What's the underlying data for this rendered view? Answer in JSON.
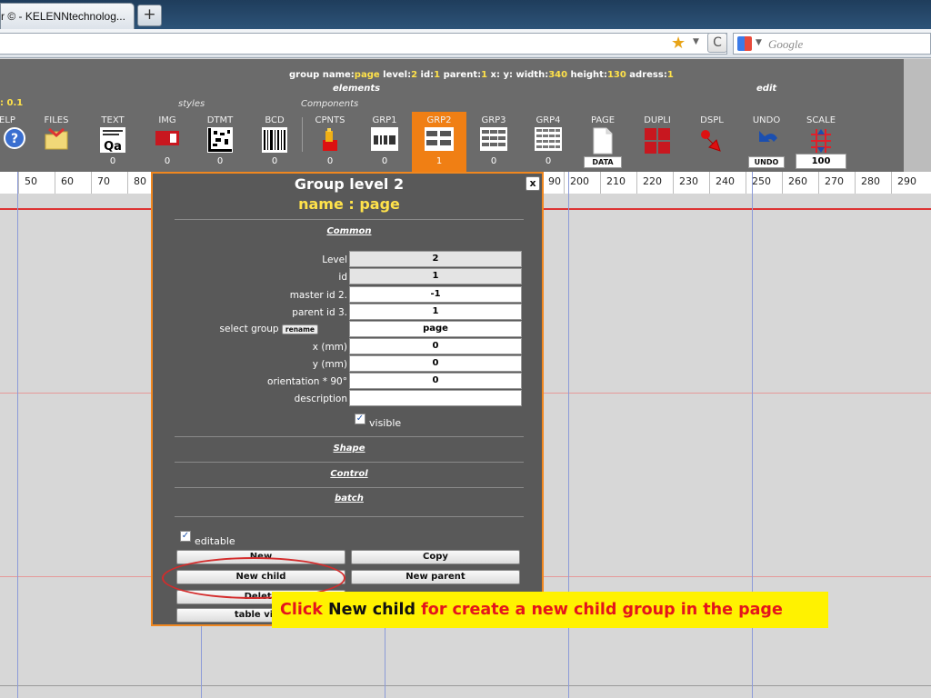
{
  "browser": {
    "tab_title": "r © - KELENNtechnolog...",
    "new_tab": "+",
    "search_placeholder": "Google",
    "reload": "C"
  },
  "toolbar": {
    "info": {
      "group_name_label": "group name:",
      "group_name": "page",
      "level_label": " level:",
      "level": "2",
      "id_label": " id:",
      "id": "1",
      "parent_label": " parent:",
      "parent": "1",
      "xy_label": " x: y: width:",
      "width": "340",
      "height_label": " height:",
      "height": "130",
      "adress_label": " adress:",
      "adress": "1"
    },
    "section_elements": "elements",
    "section_edit": "edit",
    "label_styles": "styles",
    "label_components": "Components",
    "zoom": ": 0.1",
    "buttons": [
      {
        "label": "ELP",
        "count": ""
      },
      {
        "label": "FILES",
        "count": ""
      },
      {
        "label": "TEXT",
        "count": "0"
      },
      {
        "label": "IMG",
        "count": "0"
      },
      {
        "label": "DTMT",
        "count": "0"
      },
      {
        "label": "BCD",
        "count": "0"
      },
      {
        "label": "CPNTS",
        "count": "0"
      },
      {
        "label": "GRP1",
        "count": "0"
      },
      {
        "label": "GRP2",
        "count": "1"
      },
      {
        "label": "GRP3",
        "count": "0"
      },
      {
        "label": "GRP4",
        "count": "0"
      },
      {
        "label": "PAGE",
        "count": "DATA"
      },
      {
        "label": "DUPLI",
        "count": ""
      },
      {
        "label": "DSPL",
        "count": ""
      },
      {
        "label": "UNDO",
        "count": "UNDO"
      },
      {
        "label": "SCALE",
        "count": "100"
      }
    ]
  },
  "ruler": [
    "50",
    "60",
    "70",
    "80",
    "90",
    "200",
    "210",
    "220",
    "230",
    "240",
    "250",
    "260",
    "270",
    "280",
    "290"
  ],
  "dialog": {
    "title": "Group level 2",
    "subtitle": "name : page",
    "close": "x",
    "section_common": "Common",
    "fields": [
      {
        "label": "Level",
        "value": "2"
      },
      {
        "label": "id",
        "value": "1"
      },
      {
        "label": "master id 2.",
        "value": "-1"
      },
      {
        "label": "parent id 3.",
        "value": "1"
      },
      {
        "label": "select group",
        "value": "page"
      },
      {
        "label": "x (mm)",
        "value": "0"
      },
      {
        "label": "y (mm)",
        "value": "0"
      },
      {
        "label": "orientation * 90°",
        "value": "0"
      },
      {
        "label": "description",
        "value": ""
      }
    ],
    "rename_button": "rename",
    "visible_label": "visible",
    "section_shape": "Shape",
    "section_control": "Control",
    "section_batch": "batch",
    "editable_label": "editable",
    "btn_new": "New",
    "btn_copy": "Copy",
    "btn_new_child": "New child",
    "btn_new_parent": "New parent",
    "btn_delete": "Delete",
    "btn_table_view": "table view"
  },
  "callout": {
    "part1": "Click ",
    "part2": "New child",
    "part3": " for create a new child group in the page"
  },
  "colors": {
    "accent_orange": "#f07f14",
    "highlight_yellow": "#fff200",
    "callout_red": "#e4141c",
    "dialog_bg": "#595959"
  }
}
